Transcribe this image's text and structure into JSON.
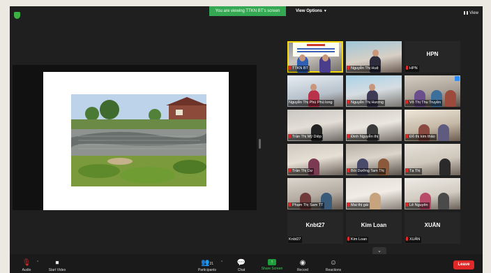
{
  "topbar": {
    "viewing_banner": "You are viewing TTKN BT's screen",
    "view_options": "View Options",
    "view_label": "View"
  },
  "gallery": {
    "tiles": [
      {
        "label": "TTKN BT",
        "active": true
      },
      {
        "label": "Nguyễn Thị Huệ"
      },
      {
        "label": "HPN",
        "big": "HPN"
      },
      {
        "label": "Nguyễn Thị Phú Phú long"
      },
      {
        "label": "Nguyễn Thị Hương"
      },
      {
        "label": "Võ Thị Thu Truyền"
      },
      {
        "label": "Trần Thị Mỹ Diệp"
      },
      {
        "label": "Đinh Nguyễn thị"
      },
      {
        "label": "Đỗ thị kim thảo"
      },
      {
        "label": "Trần Thị Dư"
      },
      {
        "label": "Bồi Dưỡng Tam Thị"
      },
      {
        "label": "Tạ Thị"
      },
      {
        "label": "Phạm Thị Sam TT"
      },
      {
        "label": "Mai thị gái"
      },
      {
        "label": "Lê Nguyên"
      },
      {
        "label": "Knbt27",
        "big": "Knbt27"
      },
      {
        "label": "Kim Loan",
        "big": "Kim Loan"
      },
      {
        "label": "XUÂN",
        "big": "XUÂN"
      }
    ],
    "scroll_icon": "chevron-down-icon"
  },
  "toolbar": {
    "audio": "Audio",
    "start_video": "Start Video",
    "participants": "Participants",
    "participants_count": "21",
    "chat": "Chat",
    "share_screen": "Share Screen",
    "record": "Record",
    "reactions": "Reactions",
    "leave": "Leave"
  },
  "colors": {
    "accent_green": "#34a853",
    "leave_red": "#e02828",
    "active_speaker": "#f5d90a",
    "window_bg": "#1f1f1f"
  }
}
